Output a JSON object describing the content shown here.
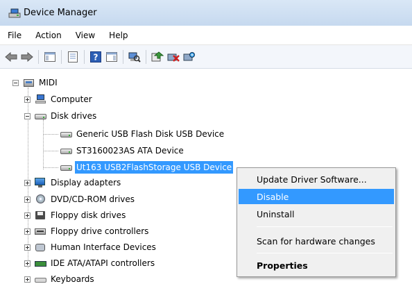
{
  "window": {
    "title": "Device Manager"
  },
  "menubar": {
    "items": [
      "File",
      "Action",
      "View",
      "Help"
    ]
  },
  "toolbar": {
    "buttons": [
      "back-icon",
      "forward-icon",
      "show-hide-console-tree-icon",
      "properties-icon",
      "help-icon",
      "action-pane-icon",
      "scan-hardware-icon",
      "update-driver-icon",
      "uninstall-icon",
      "enable-device-icon"
    ]
  },
  "tree": {
    "root": "MIDI",
    "categories": {
      "computer": "Computer",
      "disk_drives": "Disk drives",
      "display_adapters": "Display adapters",
      "dvd": "DVD/CD-ROM drives",
      "floppy_disk": "Floppy disk drives",
      "floppy_ctl": "Floppy drive controllers",
      "hid": "Human Interface Devices",
      "ide": "IDE ATA/ATAPI controllers",
      "keyboards": "Keyboards"
    },
    "disk_devices": [
      "Generic USB Flash Disk USB Device",
      "ST3160023AS ATA Device",
      "Ut163 USB2FlashStorage USB Device"
    ],
    "selected": "Ut163 USB2FlashStorage USB Device"
  },
  "context_menu": {
    "items": [
      "Update Driver Software...",
      "Disable",
      "Uninstall",
      "Scan for hardware changes",
      "Properties"
    ],
    "highlighted": "Disable"
  },
  "colors": {
    "selection": "#3399ff",
    "titlebar": "#c6d9ef"
  }
}
